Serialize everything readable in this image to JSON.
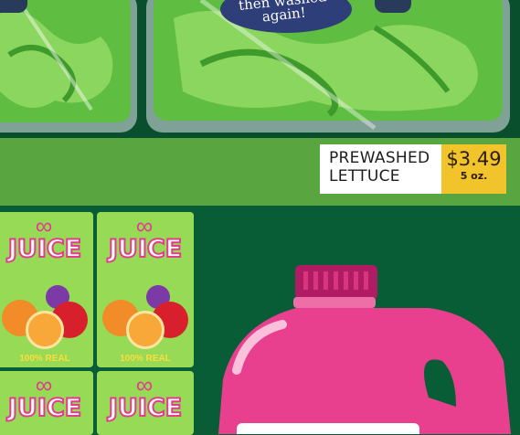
{
  "scene": {
    "aisle": "grocery shelf"
  },
  "lettuce_bubble": {
    "line1": "then washed",
    "line2": "again!"
  },
  "price_tag": {
    "name_line1": "PREWASHED",
    "name_line2": "LETTUCE",
    "price": "$3.49",
    "size": "5 oz."
  },
  "juice_box": {
    "brand": "JUICE",
    "tagline": "100% REAL"
  },
  "colors": {
    "shelf": "#59a540",
    "tag_price_bg": "#f2c42c",
    "juice_pink": "#e8408e",
    "lettuce_green": "#6cc24a"
  }
}
